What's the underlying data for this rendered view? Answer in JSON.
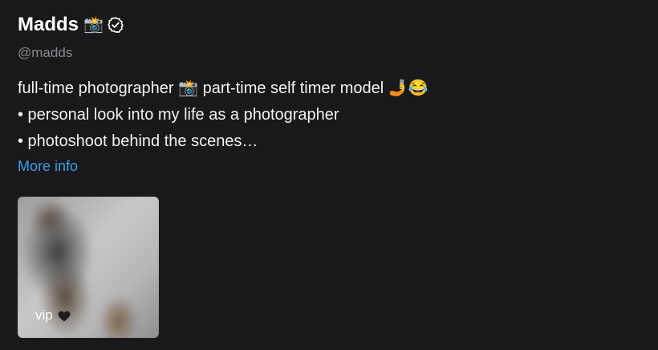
{
  "profile": {
    "display_name": "Madds",
    "name_emoji": "📸",
    "handle": "@madds",
    "bio_lines": [
      "full-time photographer 📸 part-time self timer model 🤳😂",
      "• personal look into my life as a photographer",
      "• photoshoot behind the scenes…"
    ],
    "more_info_label": "More info"
  },
  "highlight": {
    "label": "vip"
  },
  "colors": {
    "background": "#19181a",
    "text": "#ffffff",
    "handle": "#8a8a8e",
    "link": "#3b9fe6"
  },
  "icons": {
    "verified": "verified-check-icon",
    "heart": "black-heart-icon"
  }
}
